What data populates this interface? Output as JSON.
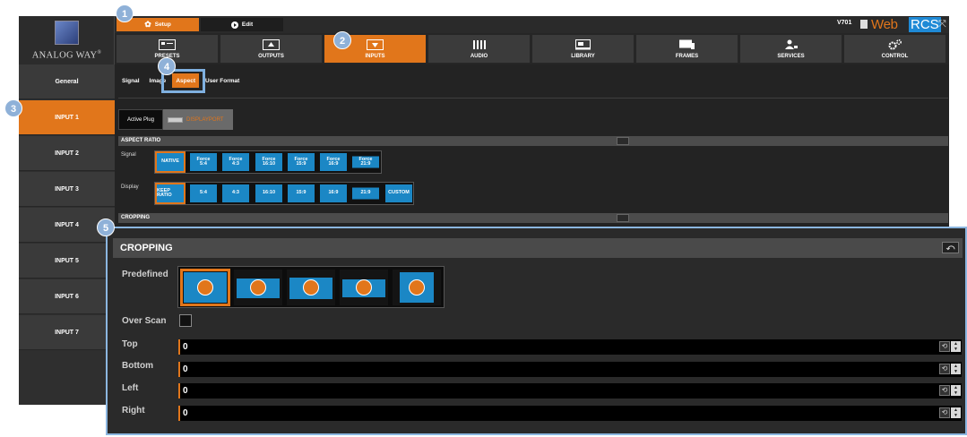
{
  "logo": {
    "brand": "ANALOG WAY",
    "reg": "®",
    "icon": "analog-way-emblem"
  },
  "topbar": {
    "setup_label": "Setup",
    "edit_label": "Edit",
    "version": "V701",
    "brand_web": "Web",
    "brand_rcs": "RCS",
    "icons": [
      "gear-icon",
      "play-icon",
      "document-icon",
      "fullscreen-icon"
    ]
  },
  "mainnav": {
    "items": [
      {
        "label": "PRESETS",
        "icon": "presets-icon"
      },
      {
        "label": "OUTPUTS",
        "icon": "outputs-icon"
      },
      {
        "label": "INPUTS",
        "icon": "inputs-icon",
        "active": true
      },
      {
        "label": "AUDIO",
        "icon": "audio-icon"
      },
      {
        "label": "LIBRARY",
        "icon": "library-icon"
      },
      {
        "label": "FRAMES",
        "icon": "frames-icon"
      },
      {
        "label": "SERVICES",
        "icon": "services-icon"
      },
      {
        "label": "CONTROL",
        "icon": "control-icon"
      }
    ]
  },
  "sidebar": {
    "items": [
      {
        "label": "General"
      },
      {
        "label": "INPUT 1",
        "active": true
      },
      {
        "label": "INPUT 2"
      },
      {
        "label": "INPUT 3"
      },
      {
        "label": "INPUT 4"
      },
      {
        "label": "INPUT 5"
      },
      {
        "label": "INPUT 6"
      },
      {
        "label": "INPUT 7"
      }
    ]
  },
  "subtabs": [
    {
      "label": "Signal"
    },
    {
      "label": "Image"
    },
    {
      "label": "Aspect",
      "active": true
    },
    {
      "label": "User Format"
    }
  ],
  "active_plug": {
    "label": "Active Plug",
    "value": "DISPLAYPORT"
  },
  "aspect_ratio": {
    "title": "ASPECT RATIO",
    "signal_label": "Signal",
    "signal_options": [
      {
        "top": "",
        "label": "NATIVE",
        "selected": true
      },
      {
        "top": "Force",
        "label": "5:4"
      },
      {
        "top": "Force",
        "label": "4:3"
      },
      {
        "top": "Force",
        "label": "16:10"
      },
      {
        "top": "Force",
        "label": "15:9"
      },
      {
        "top": "Force",
        "label": "16:9"
      },
      {
        "top": "Force",
        "label": "21:9"
      }
    ],
    "display_label": "Display",
    "display_options": [
      {
        "label": "KEEP RATIO",
        "selected": true
      },
      {
        "label": "5:4"
      },
      {
        "label": "4:3"
      },
      {
        "label": "16:10"
      },
      {
        "label": "15:9"
      },
      {
        "label": "16:9"
      },
      {
        "label": "21:9"
      },
      {
        "label": "CUSTOM"
      }
    ]
  },
  "cropping_small": {
    "title": "CROPPING"
  },
  "cropping": {
    "title": "CROPPING",
    "predefined_label": "Predefined",
    "overscan_label": "Over Scan",
    "fields": [
      {
        "label": "Top",
        "value": "0"
      },
      {
        "label": "Bottom",
        "value": "0"
      },
      {
        "label": "Left",
        "value": "0"
      },
      {
        "label": "Right",
        "value": "0"
      }
    ]
  },
  "callouts": [
    "1",
    "2",
    "3",
    "4",
    "5"
  ],
  "colors": {
    "accent": "#e1761b",
    "blue": "#1b87c5",
    "callout": "#8fb1d8"
  }
}
